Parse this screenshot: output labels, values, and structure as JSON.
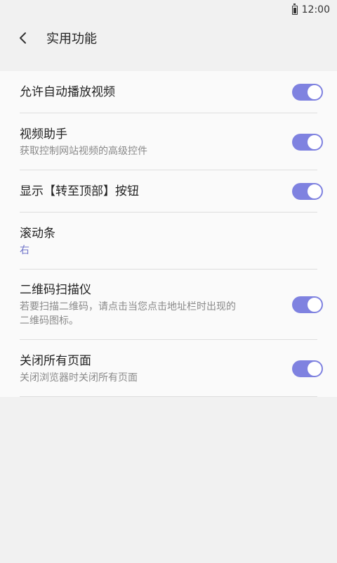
{
  "status": {
    "time": "12:00"
  },
  "header": {
    "title": "实用功能"
  },
  "settings": [
    {
      "title": "允许自动播放视频",
      "subtitle": "",
      "value": "",
      "toggle": true
    },
    {
      "title": "视频助手",
      "subtitle": "获取控制网站视频的高级控件",
      "value": "",
      "toggle": true
    },
    {
      "title": "显示【转至顶部】按钮",
      "subtitle": "",
      "value": "",
      "toggle": true
    },
    {
      "title": "滚动条",
      "subtitle": "",
      "value": "右",
      "toggle": false
    },
    {
      "title": "二维码扫描仪",
      "subtitle_line1": "若要扫描二维码，请点击当您点击地址栏时出现的",
      "subtitle_line2": "二维码图标。",
      "value": "",
      "toggle": true
    },
    {
      "title": "关闭所有页面",
      "subtitle": "关闭浏览器时关闭所有页面",
      "value": "",
      "toggle": true
    }
  ],
  "colors": {
    "accent": "#7f82e0",
    "value_text": "#6e73c8",
    "background": "#f1f1f1",
    "card": "#fafafa"
  },
  "icons": {
    "back": "chevron-left-icon",
    "battery": "battery-icon"
  }
}
